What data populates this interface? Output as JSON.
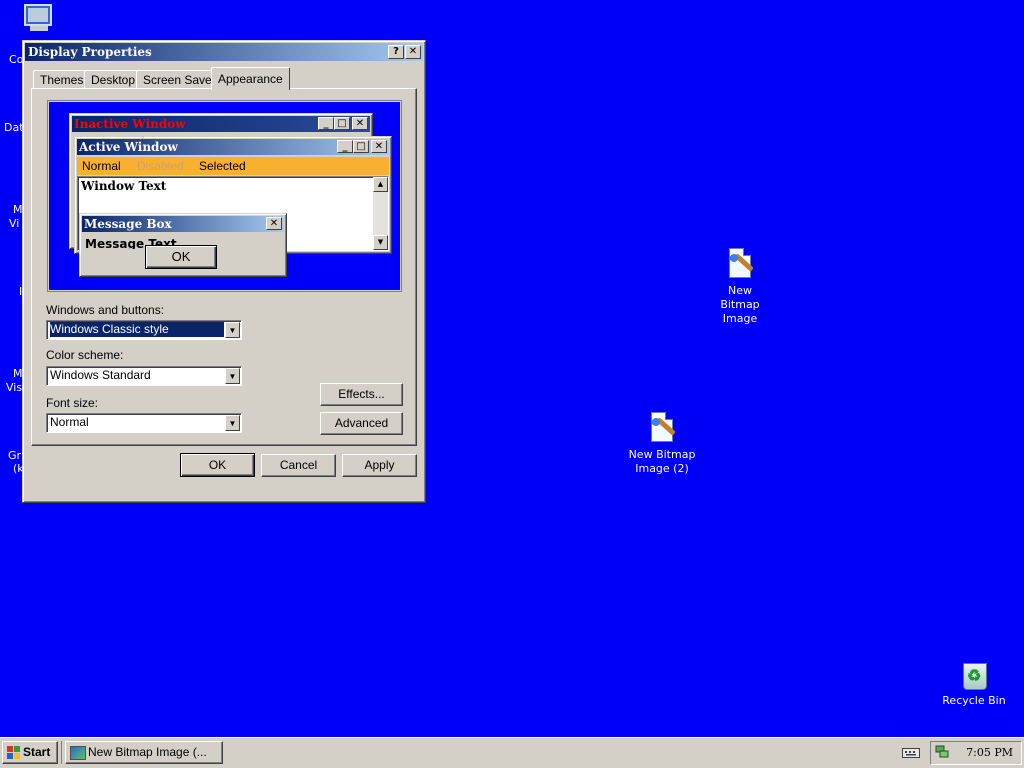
{
  "desktop": {
    "cut_labels": [
      "Co",
      "Dat",
      "M",
      "Vi",
      "I",
      "M",
      "Vis",
      "Gr",
      "(k"
    ],
    "icons": [
      {
        "label": "New Bitmap Image",
        "icon": "bitmap-paint-icon"
      },
      {
        "label": "New Bitmap Image (2)",
        "icon": "bitmap-paint-icon"
      },
      {
        "label": "Recycle Bin",
        "icon": "recycle-bin-icon"
      }
    ]
  },
  "dialog": {
    "title": "Display Properties",
    "help_glyph": "?",
    "close_glyph": "✕",
    "tabs": [
      {
        "label": "Themes",
        "active": false
      },
      {
        "label": "Desktop",
        "active": false
      },
      {
        "label": "Screen Saver",
        "active": false
      },
      {
        "label": "Appearance",
        "active": true
      }
    ],
    "preview": {
      "inactive_title": "Inactive Window",
      "active_title": "Active Window",
      "menu_items": [
        "Normal",
        "Disabled",
        "Selected"
      ],
      "window_text": "Window Text",
      "msgbox_title": "Message Box",
      "msgbox_text": "Message Text",
      "msgbox_ok": "OK"
    },
    "windows_buttons_label": "Windows and buttons:",
    "windows_buttons_value": "Windows Classic style",
    "color_scheme_label": "Color scheme:",
    "color_scheme_value": "Windows Standard",
    "font_size_label": "Font size:",
    "font_size_value": "Normal",
    "effects_button": "Effects...",
    "advanced_button": "Advanced",
    "ok_button": "OK",
    "cancel_button": "Cancel",
    "apply_button": "Apply"
  },
  "taskbar": {
    "start_label": "Start",
    "task_label": "New Bitmap Image (...",
    "clock": "7:05 PM"
  },
  "colors": {
    "desktop": "#0000f8",
    "face": "#d4d0c8",
    "active_title_start": "#0a246a",
    "active_title_end": "#a6caf0",
    "menu_bar": "#f8b030",
    "inactive_title_text": "#ff0000"
  }
}
